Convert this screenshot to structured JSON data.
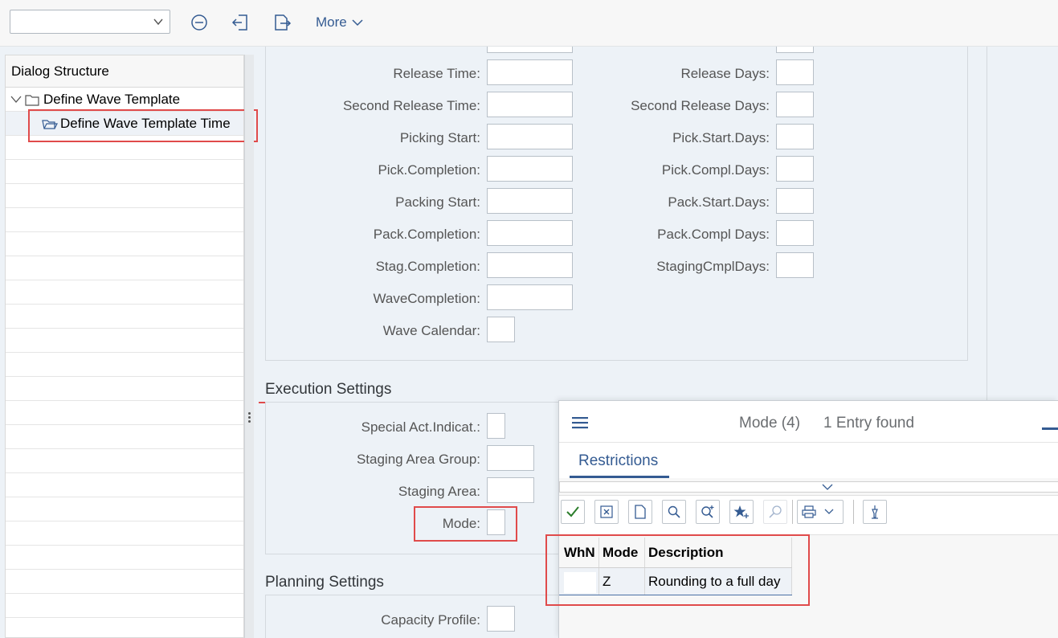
{
  "toolbar": {
    "dropdown_value": "",
    "more_label": "More",
    "icons": [
      "minus-circle-icon",
      "exit-icon",
      "export-icon"
    ]
  },
  "tree": {
    "header": "Dialog Structure",
    "items": [
      {
        "label": "Define Wave Template",
        "icon": "folder-icon",
        "expanded": true
      },
      {
        "label": "Define Wave Template Time",
        "icon": "open-folder-icon",
        "selected": true
      }
    ]
  },
  "time_fields": {
    "left": [
      {
        "label": "Release Time:",
        "value": ""
      },
      {
        "label": "Second Release Time:",
        "value": ""
      },
      {
        "label": "Picking Start:",
        "value": ""
      },
      {
        "label": "Pick.Completion:",
        "value": ""
      },
      {
        "label": "Packing Start:",
        "value": ""
      },
      {
        "label": "Pack.Completion:",
        "value": ""
      },
      {
        "label": "Stag.Completion:",
        "value": ""
      },
      {
        "label": "WaveCompletion:",
        "value": ""
      },
      {
        "label": "Wave Calendar:",
        "value": ""
      }
    ],
    "right": [
      {
        "label": "Release Days:",
        "value": ""
      },
      {
        "label": "Second Release Days:",
        "value": ""
      },
      {
        "label": "Pick.Start.Days:",
        "value": ""
      },
      {
        "label": "Pick.Compl.Days:",
        "value": ""
      },
      {
        "label": "Pack.Start.Days:",
        "value": ""
      },
      {
        "label": "Pack.Compl Days:",
        "value": ""
      },
      {
        "label": "StagingCmplDays:",
        "value": ""
      }
    ]
  },
  "execution": {
    "title": "Execution Settings",
    "fields": [
      {
        "label": "Special Act.Indicat.:",
        "value": ""
      },
      {
        "label": "Staging Area Group:",
        "value": ""
      },
      {
        "label": "Staging Area:",
        "value": ""
      },
      {
        "label": "Mode:",
        "value": ""
      }
    ]
  },
  "planning": {
    "title": "Planning Settings",
    "fields": [
      {
        "label": "Capacity Profile:",
        "value": ""
      }
    ]
  },
  "popup": {
    "title": "Mode (4)",
    "count": "1 Entry found",
    "tab": "Restrictions",
    "columns": [
      "WhN",
      "Mode",
      "Description"
    ],
    "rows": [
      {
        "whn": "",
        "mode": "Z",
        "description": "Rounding to a full day"
      }
    ],
    "accent": "#345b92",
    "highlight": "#e04b4b"
  }
}
